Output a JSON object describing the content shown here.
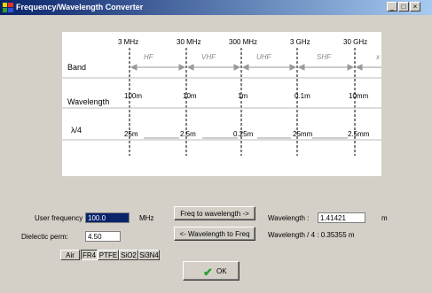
{
  "window": {
    "title": "Frequency/Wavelength Converter",
    "controls": [
      "_",
      "□",
      "×"
    ]
  },
  "chart": {
    "freq_ticks": [
      "3 MHz",
      "30 MHz",
      "300 MHz",
      "3 GHz",
      "30 GHz"
    ],
    "row_labels": {
      "band": "Band",
      "wavelength": "Wavelength",
      "quarter": "λ/4"
    },
    "bands": [
      "HF",
      "VHF",
      "UHF",
      "SHF",
      "x"
    ],
    "wavelengths": [
      "100m",
      "10m",
      "1m",
      "0.1m",
      "10mm"
    ],
    "quarter_wavelengths": [
      "25m",
      "2.5m",
      "0.25m",
      "25mm",
      "2.5mm"
    ]
  },
  "photos": [
    "airplane-photo",
    "car-photo",
    "city-aerial-photo",
    "chip-photo",
    "cables-photo"
  ],
  "form": {
    "user_frequency_label": "User frequency",
    "user_frequency_value": "100.0",
    "unit_mhz": "MHz",
    "dielectric_label": "Dielectic perm:",
    "dielectric_value": "4.50",
    "freq_to_wl_button": "Freq to wavelength ->",
    "wl_to_freq_button": "<- Wavelength to Freq",
    "wavelength_label": "Wavelength :",
    "wavelength_value": "1.41421",
    "unit_m": "m",
    "quarter_text": "Wavelength / 4 : 0.35355 m"
  },
  "materials": {
    "items": [
      "Air",
      "FR4",
      "PTFE",
      "SiO2",
      "Si3N4"
    ],
    "selected": "FR4"
  },
  "ok_button": "OK"
}
